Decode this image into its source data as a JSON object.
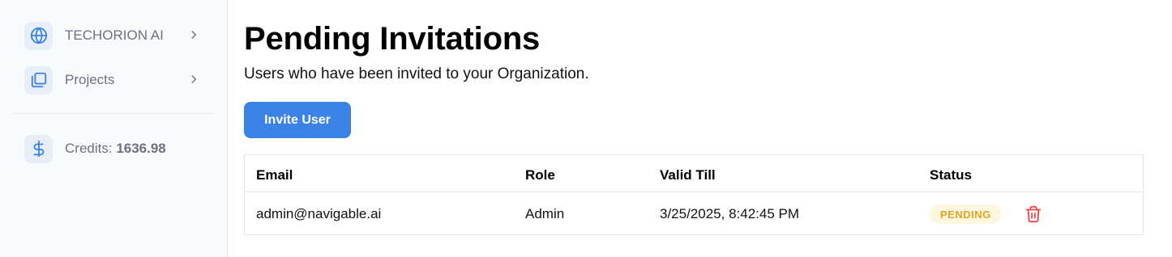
{
  "sidebar": {
    "items": [
      {
        "label": "TECHORION AI",
        "icon": "globe-icon"
      },
      {
        "label": "Projects",
        "icon": "folders-icon"
      }
    ],
    "credits": {
      "label": "Credits:",
      "value": "1636.98",
      "icon": "dollar-icon"
    }
  },
  "main": {
    "title": "Pending Invitations",
    "subtitle": "Users who have been invited to your Organization.",
    "invite_button": "Invite User"
  },
  "table": {
    "headers": [
      "Email",
      "Role",
      "Valid Till",
      "Status"
    ],
    "rows": [
      {
        "email": "admin@navigable.ai",
        "role": "Admin",
        "valid_till": "3/25/2025, 8:42:45 PM",
        "status": "PENDING"
      }
    ]
  },
  "colors": {
    "accent": "#3b82e6",
    "pending_text": "#e5a324",
    "pending_bg": "#fef7e0",
    "delete": "#ef4444"
  }
}
